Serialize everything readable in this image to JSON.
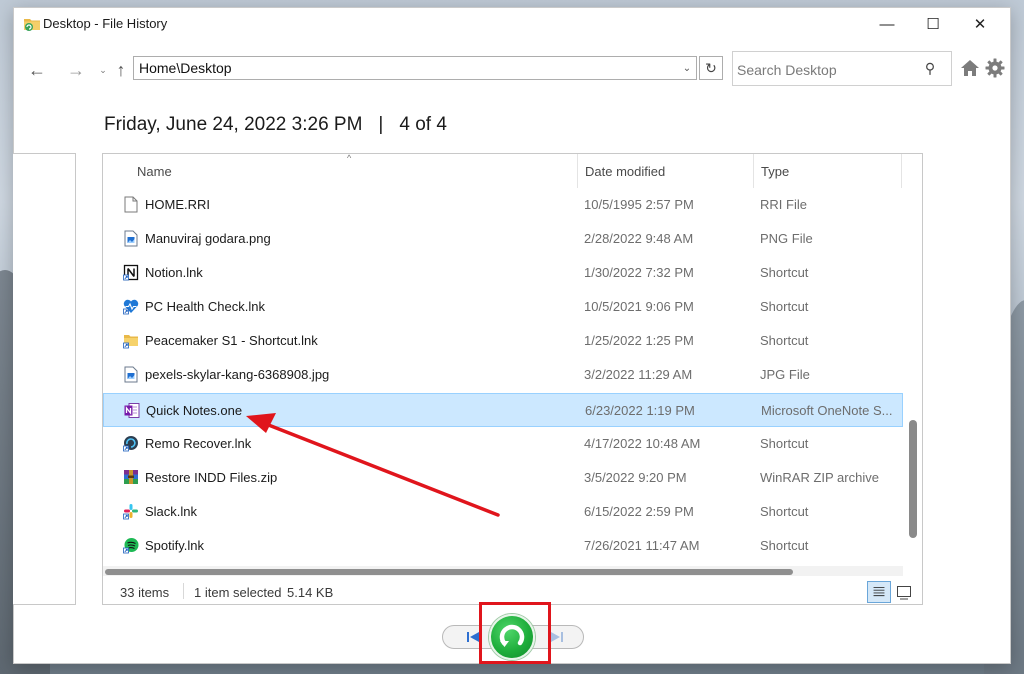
{
  "window": {
    "title": "Desktop - File History",
    "minimize_glyph": "—",
    "maximize_glyph": "☐",
    "close_glyph": "✕"
  },
  "nav": {
    "back_glyph": "←",
    "forward_glyph": "→",
    "recent_glyph": "⌄",
    "up_glyph": "↑",
    "address": "Home\\Desktop",
    "address_dropdown_glyph": "⌄",
    "refresh_glyph": "↻",
    "search_placeholder": "Search Desktop",
    "search_glyph": "⚲"
  },
  "snapshot": {
    "date": "Friday, June 24, 2022 3:26 PM",
    "separator": "|",
    "position": "4 of 4"
  },
  "columns": {
    "name": "Name",
    "date": "Date modified",
    "type": "Type",
    "sort_caret": "^"
  },
  "files": [
    {
      "name": "HOME.RRI",
      "date": "10/5/1995 2:57 PM",
      "type": "RRI File",
      "icon": "blank-file-icon"
    },
    {
      "name": "Manuviraj godara.png",
      "date": "2/28/2022 9:48 AM",
      "type": "PNG File",
      "icon": "image-file-icon"
    },
    {
      "name": "Notion.lnk",
      "date": "1/30/2022 7:32 PM",
      "type": "Shortcut",
      "icon": "notion-icon"
    },
    {
      "name": "PC Health Check.lnk",
      "date": "10/5/2021 9:06 PM",
      "type": "Shortcut",
      "icon": "health-check-icon"
    },
    {
      "name": "Peacemaker S1 - Shortcut.lnk",
      "date": "1/25/2022 1:25 PM",
      "type": "Shortcut",
      "icon": "folder-shortcut-icon"
    },
    {
      "name": "pexels-skylar-kang-6368908.jpg",
      "date": "3/2/2022 11:29 AM",
      "type": "JPG File",
      "icon": "image-file-icon"
    },
    {
      "name": "Quick Notes.one",
      "date": "6/23/2022 1:19 PM",
      "type": "Microsoft OneNote S...",
      "icon": "onenote-icon",
      "selected": true
    },
    {
      "name": "Remo Recover.lnk",
      "date": "4/17/2022 10:48 AM",
      "type": "Shortcut",
      "icon": "remo-recover-icon"
    },
    {
      "name": "Restore INDD Files.zip",
      "date": "3/5/2022 9:20 PM",
      "type": "WinRAR ZIP archive",
      "icon": "winrar-icon"
    },
    {
      "name": "Slack.lnk",
      "date": "6/15/2022 2:59 PM",
      "type": "Shortcut",
      "icon": "slack-icon"
    },
    {
      "name": "Spotify.lnk",
      "date": "7/26/2021 11:47 AM",
      "type": "Shortcut",
      "icon": "spotify-icon"
    }
  ],
  "status": {
    "count": "33 items",
    "selected": "1 item selected",
    "size": "5.14 KB"
  },
  "colors": {
    "selection_bg": "#cce8ff",
    "selection_border": "#99d1ff",
    "restore_green": "#1fae3c",
    "annotation_red": "#e0151c"
  }
}
